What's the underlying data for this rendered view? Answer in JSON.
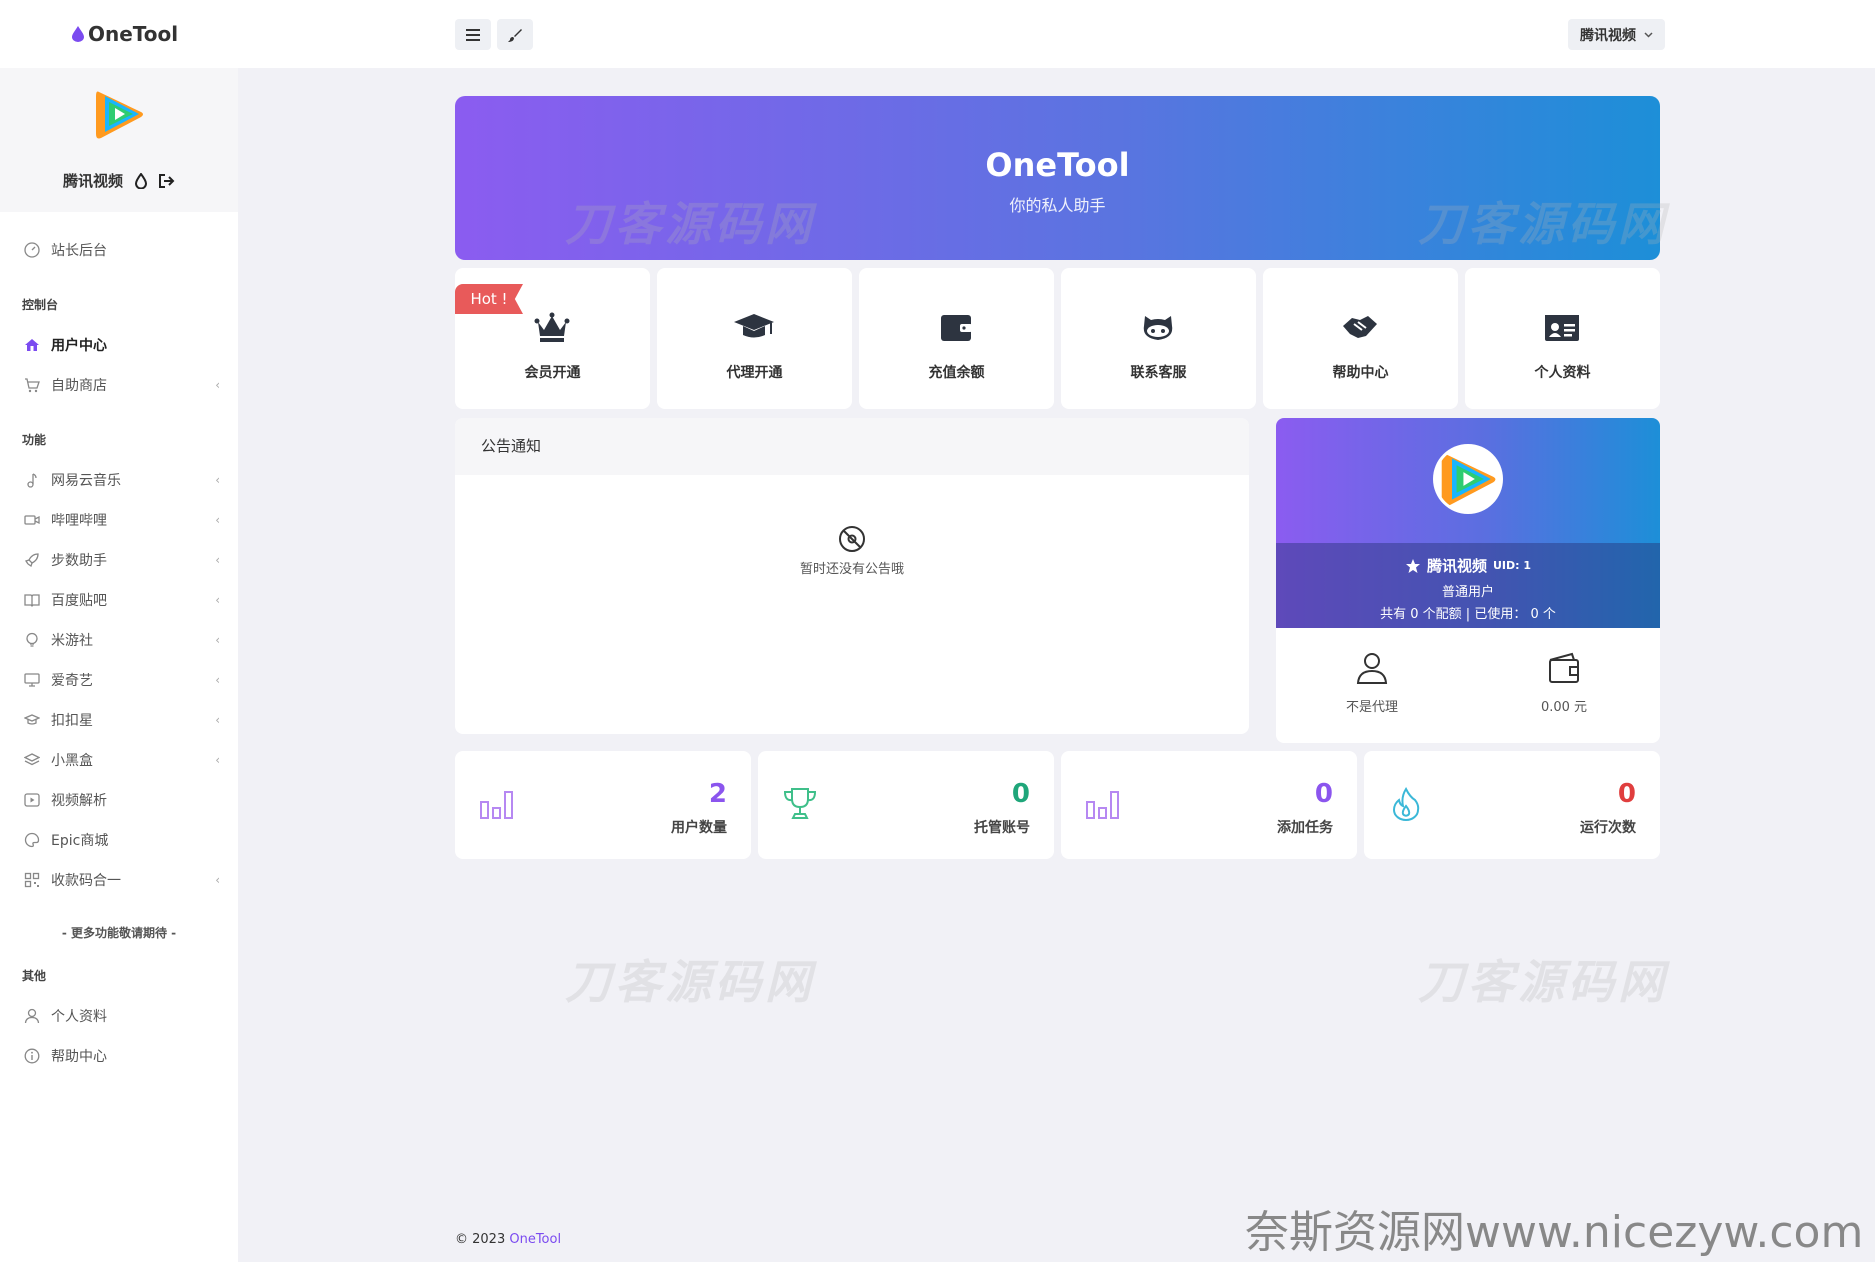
{
  "app": {
    "brand": "OneTool"
  },
  "header": {
    "user_menu_label": "腾讯视频"
  },
  "sidebar": {
    "profile_name": "腾讯视频",
    "avatar_text": "腾讯视频",
    "top_item": "站长后台",
    "sections": [
      {
        "title": "控制台",
        "items": [
          "用户中心",
          "自助商店"
        ]
      },
      {
        "title": "功能",
        "items": [
          "网易云音乐",
          "哔哩哔哩",
          "步数助手",
          "百度贴吧",
          "米游社",
          "爱奇艺",
          "扣扣星",
          "小黑盒",
          "视频解析",
          "Epic商城",
          "收款码合一"
        ]
      },
      {
        "title": "其他",
        "items": [
          "个人资料",
          "帮助中心"
        ]
      }
    ],
    "more_text": "- 更多功能敬请期待 -"
  },
  "hero": {
    "title": "OneTool",
    "subtitle": "你的私人助手"
  },
  "watermark": "刀客源码网",
  "quick": {
    "hot_badge": "Hot !",
    "items": [
      "会员开通",
      "代理开通",
      "充值余额",
      "联系客服",
      "帮助中心",
      "个人资料"
    ]
  },
  "notice": {
    "title": "公告通知",
    "empty": "暂时还没有公告哦"
  },
  "user_card": {
    "name": "腾讯视频",
    "uid": "UID: 1",
    "role": "普通用户",
    "quota": "共有 0 个配额 | 已使用： 0 个",
    "agent_status": "不是代理",
    "balance": "0.00 元"
  },
  "stats": [
    {
      "value": "2",
      "label": "用户数量",
      "color": "#8b55ee"
    },
    {
      "value": "0",
      "label": "托管账号",
      "color": "#1fa67a"
    },
    {
      "value": "0",
      "label": "添加任务",
      "color": "#8b55ee"
    },
    {
      "value": "0",
      "label": "运行次数",
      "color": "#e03e3e"
    }
  ],
  "footer": {
    "copyright": "© 2023 ",
    "brand": "OneTool"
  },
  "site_watermark": "奈斯资源网www.nicezyw.com"
}
